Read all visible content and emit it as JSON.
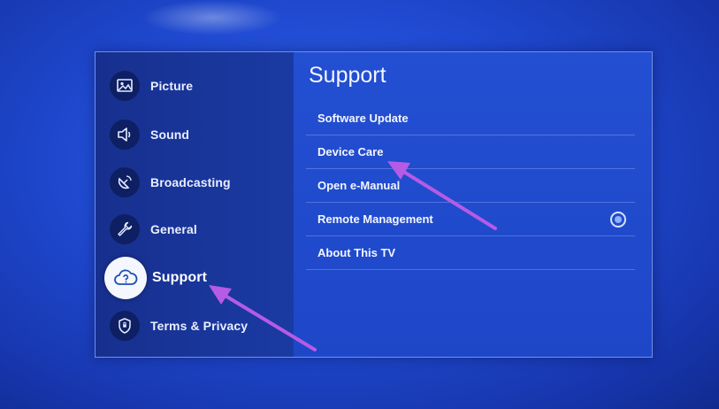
{
  "sidebar": {
    "items": [
      {
        "label": "Picture",
        "icon": "picture-icon"
      },
      {
        "label": "Sound",
        "icon": "speaker-icon"
      },
      {
        "label": "Broadcasting",
        "icon": "satellite-dish-icon"
      },
      {
        "label": "General",
        "icon": "wrench-icon"
      },
      {
        "label": "Support",
        "icon": "cloud-question-icon",
        "active": true
      },
      {
        "label": "Terms & Privacy",
        "icon": "shield-icon"
      }
    ]
  },
  "content": {
    "title": "Support",
    "items": [
      {
        "label": "Software Update"
      },
      {
        "label": "Device Care"
      },
      {
        "label": "Open e-Manual"
      },
      {
        "label": "Remote Management",
        "control": "radio"
      },
      {
        "label": "About This TV"
      }
    ]
  },
  "annotations": {
    "arrow_color": "#b65be6"
  },
  "colors": {
    "background": "#1f49d0",
    "sidebar": "#17308f",
    "text": "#f3f6ff"
  }
}
